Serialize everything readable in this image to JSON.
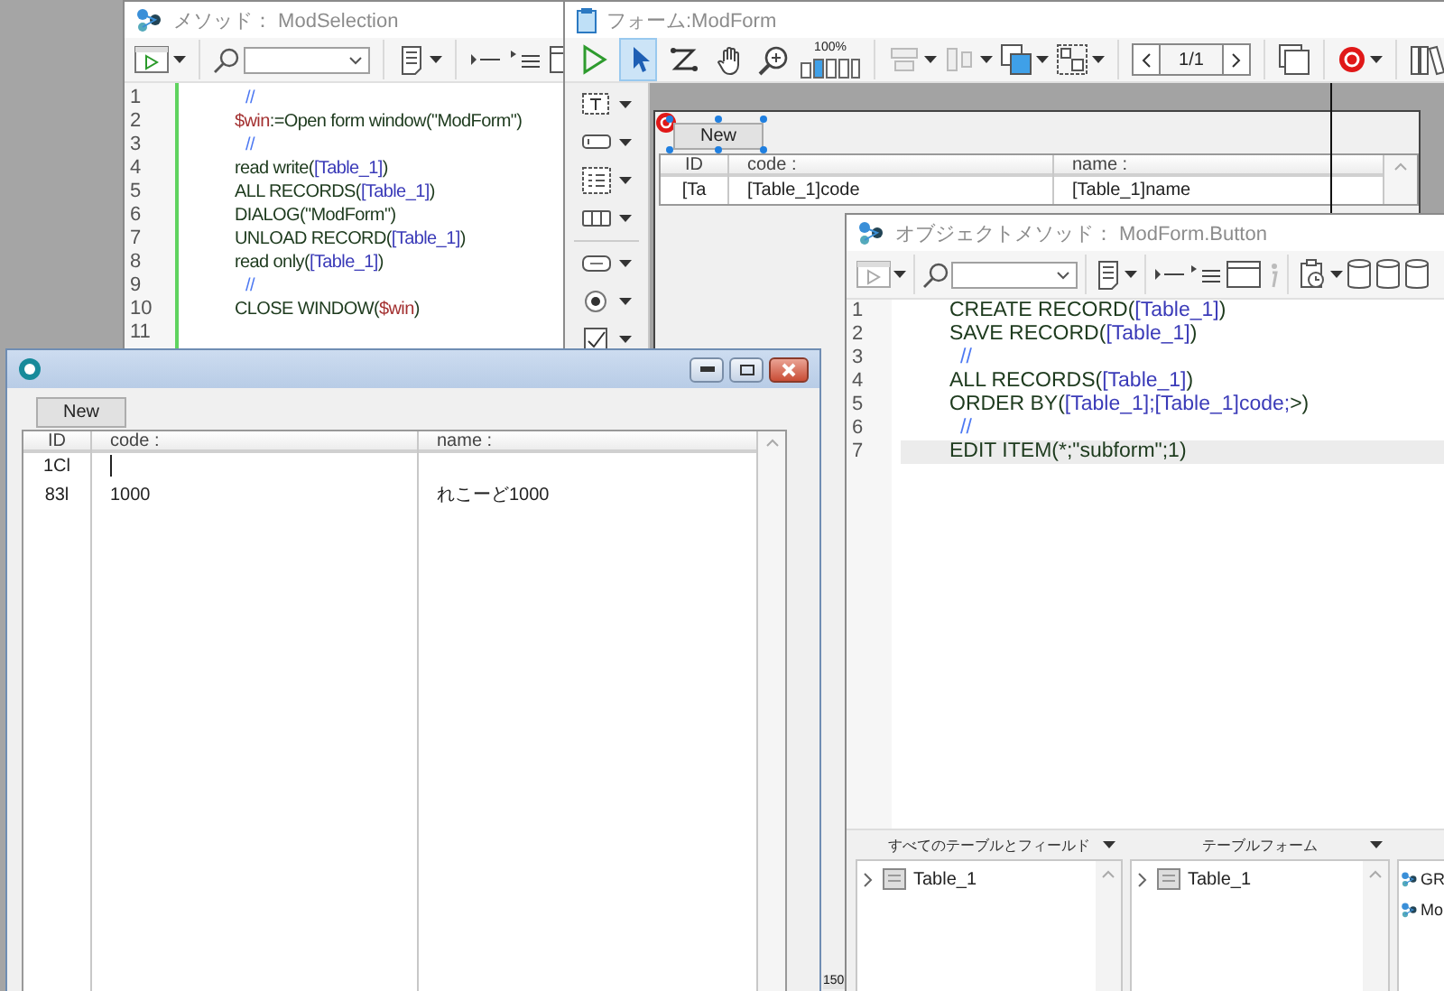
{
  "method_window": {
    "title": "メソッド： ModSelection",
    "lines": [
      {
        "number": "1",
        "tokens": [
          {
            "kind": "comment",
            "text": "//"
          }
        ]
      },
      {
        "number": "2",
        "tokens": [
          {
            "kind": "variable",
            "text": "$win"
          },
          {
            "kind": "command",
            "text": ":=Open form window(\"ModForm\")"
          }
        ]
      },
      {
        "number": "3",
        "tokens": [
          {
            "kind": "comment",
            "text": "//"
          }
        ]
      },
      {
        "number": "4",
        "tokens": [
          {
            "kind": "command",
            "text": "read write("
          },
          {
            "kind": "table",
            "text": "[Table_1]"
          },
          {
            "kind": "command",
            "text": ")"
          }
        ]
      },
      {
        "number": "5",
        "tokens": [
          {
            "kind": "command",
            "text": "ALL RECORDS("
          },
          {
            "kind": "table",
            "text": "[Table_1]"
          },
          {
            "kind": "command",
            "text": ")"
          }
        ]
      },
      {
        "number": "6",
        "tokens": [
          {
            "kind": "command",
            "text": "DIALOG(\"ModForm\")"
          }
        ]
      },
      {
        "number": "7",
        "tokens": [
          {
            "kind": "command",
            "text": "UNLOAD RECORD("
          },
          {
            "kind": "table",
            "text": "[Table_1]"
          },
          {
            "kind": "command",
            "text": ")"
          }
        ]
      },
      {
        "number": "8",
        "tokens": [
          {
            "kind": "command",
            "text": "read only("
          },
          {
            "kind": "table",
            "text": "[Table_1]"
          },
          {
            "kind": "command",
            "text": ")"
          }
        ]
      },
      {
        "number": "9",
        "tokens": [
          {
            "kind": "comment",
            "text": "//"
          }
        ]
      },
      {
        "number": "10",
        "tokens": [
          {
            "kind": "command",
            "text": "CLOSE WINDOW("
          },
          {
            "kind": "variable",
            "text": "$win"
          },
          {
            "kind": "command",
            "text": ")"
          }
        ]
      },
      {
        "number": "11"
      }
    ]
  },
  "form_window": {
    "title": "フォーム:ModForm",
    "tools": [
      {
        "kind": "run",
        "selected": false
      },
      {
        "kind": "pointer",
        "selected": true
      },
      {
        "kind": "path",
        "selected": false
      },
      {
        "kind": "hand",
        "selected": false
      },
      {
        "kind": "zoom",
        "selected": false
      }
    ],
    "zoom": "100%",
    "page": "1/1",
    "form": {
      "button": "New",
      "columns": [
        "ID",
        "code :",
        "name :"
      ],
      "rows": [
        {
          "cells": [
            "[Ta",
            "[Table_1]code",
            "[Table_1]name"
          ]
        }
      ]
    },
    "ruler": "150"
  },
  "object_method_window": {
    "title": "オブジェクトメソッド： ModForm.Button",
    "lines": [
      {
        "number": "1",
        "selected": false,
        "tokens": [
          {
            "kind": "command",
            "text": "CREATE RECORD("
          },
          {
            "kind": "table",
            "text": "[Table_1]"
          },
          {
            "kind": "command",
            "text": ")"
          }
        ]
      },
      {
        "number": "2",
        "selected": false,
        "tokens": [
          {
            "kind": "command",
            "text": "SAVE RECORD("
          },
          {
            "kind": "table",
            "text": "[Table_1]"
          },
          {
            "kind": "command",
            "text": ")"
          }
        ]
      },
      {
        "number": "3",
        "selected": false,
        "tokens": [
          {
            "kind": "comment",
            "text": "//"
          }
        ]
      },
      {
        "number": "4",
        "selected": false,
        "tokens": [
          {
            "kind": "command",
            "text": "ALL RECORDS("
          },
          {
            "kind": "table",
            "text": "[Table_1]"
          },
          {
            "kind": "command",
            "text": ")"
          }
        ]
      },
      {
        "number": "5",
        "selected": false,
        "tokens": [
          {
            "kind": "command",
            "text": "ORDER BY("
          },
          {
            "kind": "table",
            "text": "[Table_1];[Table_1]code;"
          },
          {
            "kind": "command",
            "text": ">)"
          }
        ]
      },
      {
        "number": "6",
        "selected": false,
        "tokens": [
          {
            "kind": "comment",
            "text": "//"
          }
        ]
      },
      {
        "number": "7",
        "selected": true,
        "tokens": [
          {
            "kind": "command",
            "text": "EDIT ITEM(*;\"subform\";1)"
          }
        ]
      }
    ],
    "panels": [
      {
        "title": "すべてのテーブルとフィールド",
        "items": [
          {
            "kind": "table",
            "label": "Table_1",
            "expanded": false
          }
        ]
      },
      {
        "title": "テーブルフォーム",
        "items": [
          {
            "kind": "table",
            "label": "Table_1",
            "expanded": false
          }
        ]
      },
      {
        "items": [
          {
            "kind": "method",
            "label": "GR"
          },
          {
            "kind": "method",
            "label": "Mo"
          }
        ]
      }
    ]
  },
  "runtime_window": {
    "button": "New",
    "columns": [
      "ID",
      "code :",
      "name :"
    ],
    "rows": [
      {
        "id": "1Cl",
        "editing": true
      },
      {
        "id": "83l",
        "code": "1000",
        "name": "れこーど1000",
        "editing": false
      }
    ]
  }
}
